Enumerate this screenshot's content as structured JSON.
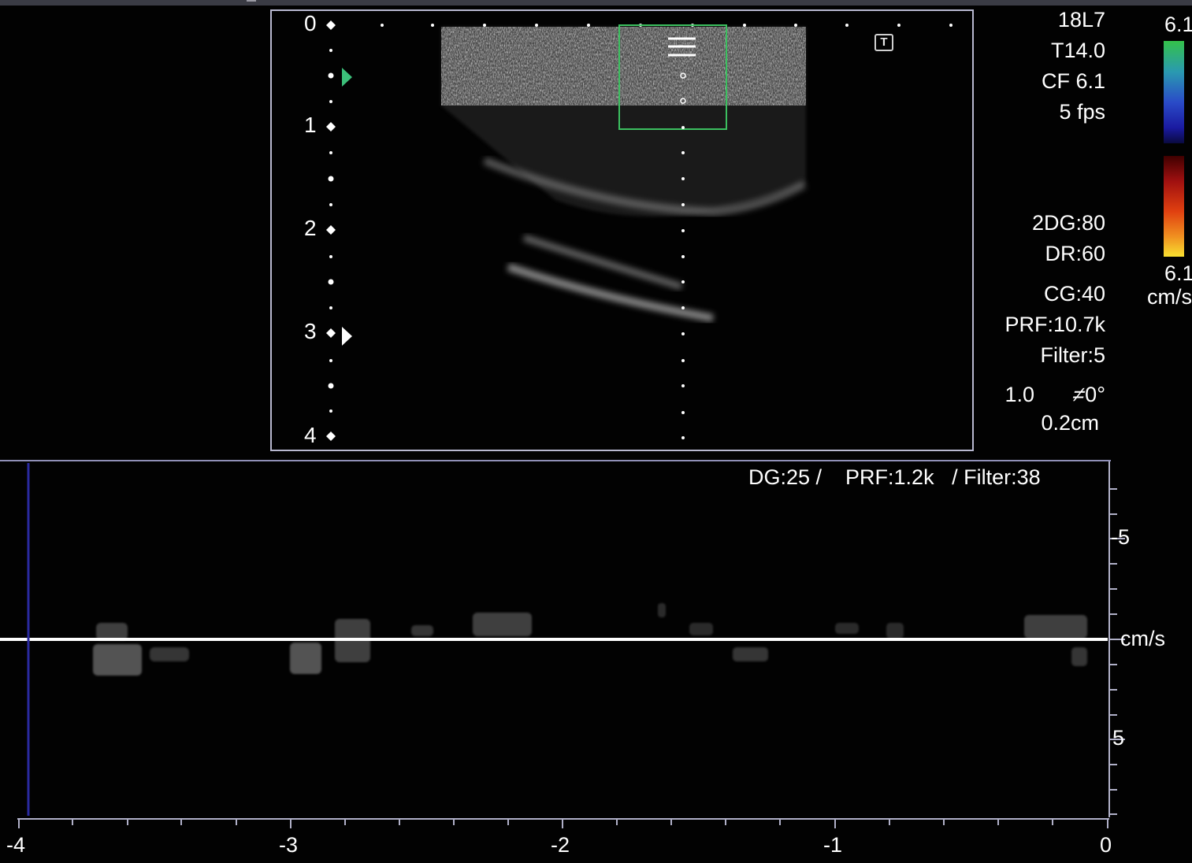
{
  "depth_scale": {
    "labels": [
      "0",
      "1",
      "2",
      "3",
      "4"
    ]
  },
  "probe_info": {
    "probe": "18L7",
    "mode": "T14.0",
    "cf": "CF 6.1",
    "frame_rate": "5 fps"
  },
  "image_settings": {
    "gain_2d": "2DG:80",
    "dynamic_range": "DR:60",
    "color_gain": "CG:40",
    "prf": "PRF:10.7k",
    "filter": "Filter:5",
    "sample_value": "1.0",
    "angle": "0°",
    "gate_size": "0.2cm"
  },
  "color_scale": {
    "top_value": "6.1",
    "bottom_value": "6.1",
    "unit": "cm/s"
  },
  "t_icon_label": "T",
  "doppler": {
    "header": "DG:25 /    PRF:1.2k   / Filter:38",
    "velocity_labels": {
      "upper": "-5",
      "baseline": "cm/s",
      "lower": "5"
    },
    "time_axis": {
      "labels": [
        "-4",
        "-3",
        "-2",
        "-1",
        "0"
      ]
    }
  },
  "colors": {
    "frame": "#b8b8d0",
    "color_box": "#3cc060",
    "marker_green": "#3cc07a",
    "sweep_line": "#2a2aa0"
  }
}
